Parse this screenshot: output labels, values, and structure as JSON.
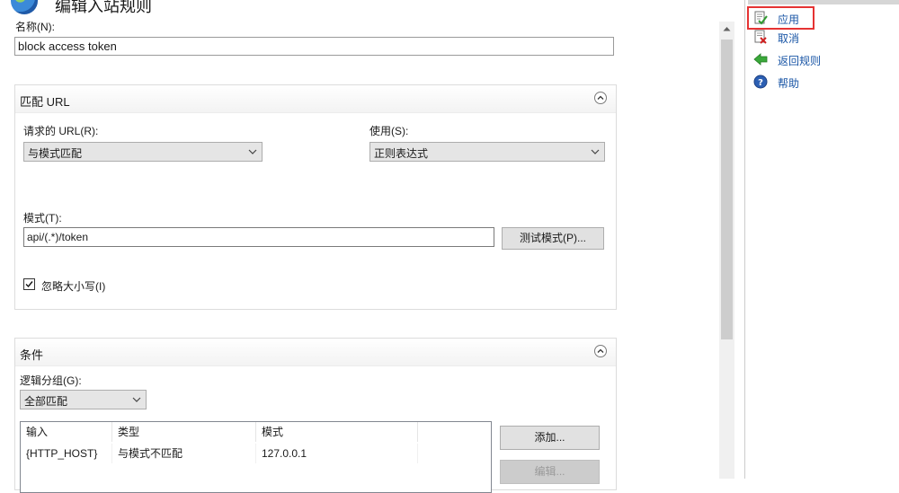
{
  "header": {
    "title": "编辑入站规则",
    "name_label": "名称(N):",
    "name_value": "block access  token"
  },
  "match_url": {
    "title": "匹配 URL",
    "requested_url_label": "请求的 URL(R):",
    "requested_url_value": "与模式匹配",
    "using_label": "使用(S):",
    "using_value": "正则表达式",
    "pattern_label": "模式(T):",
    "pattern_value": "api/(.*)/token",
    "test_button": "测试模式(P)...",
    "ignore_case_label": "忽略大小写(I)",
    "ignore_case_checked": true
  },
  "conditions": {
    "title": "条件",
    "logical_grouping_label": "逻辑分组(G):",
    "logical_grouping_value": "全部匹配",
    "columns": [
      "输入",
      "类型",
      "模式"
    ],
    "rows": [
      {
        "input": "{HTTP_HOST}",
        "type": "与模式不匹配",
        "pattern": "127.0.0.1"
      }
    ],
    "add_button": "添加...",
    "edit_button": "编辑..."
  },
  "actions": {
    "items": [
      {
        "label": "应用",
        "icon": "apply-icon"
      },
      {
        "label": "取消",
        "icon": "cancel-icon"
      },
      {
        "label": "返回规则",
        "icon": "back-arrow-icon"
      },
      {
        "label": "帮助",
        "icon": "help-icon"
      }
    ],
    "highlight_color": "#e53333"
  }
}
